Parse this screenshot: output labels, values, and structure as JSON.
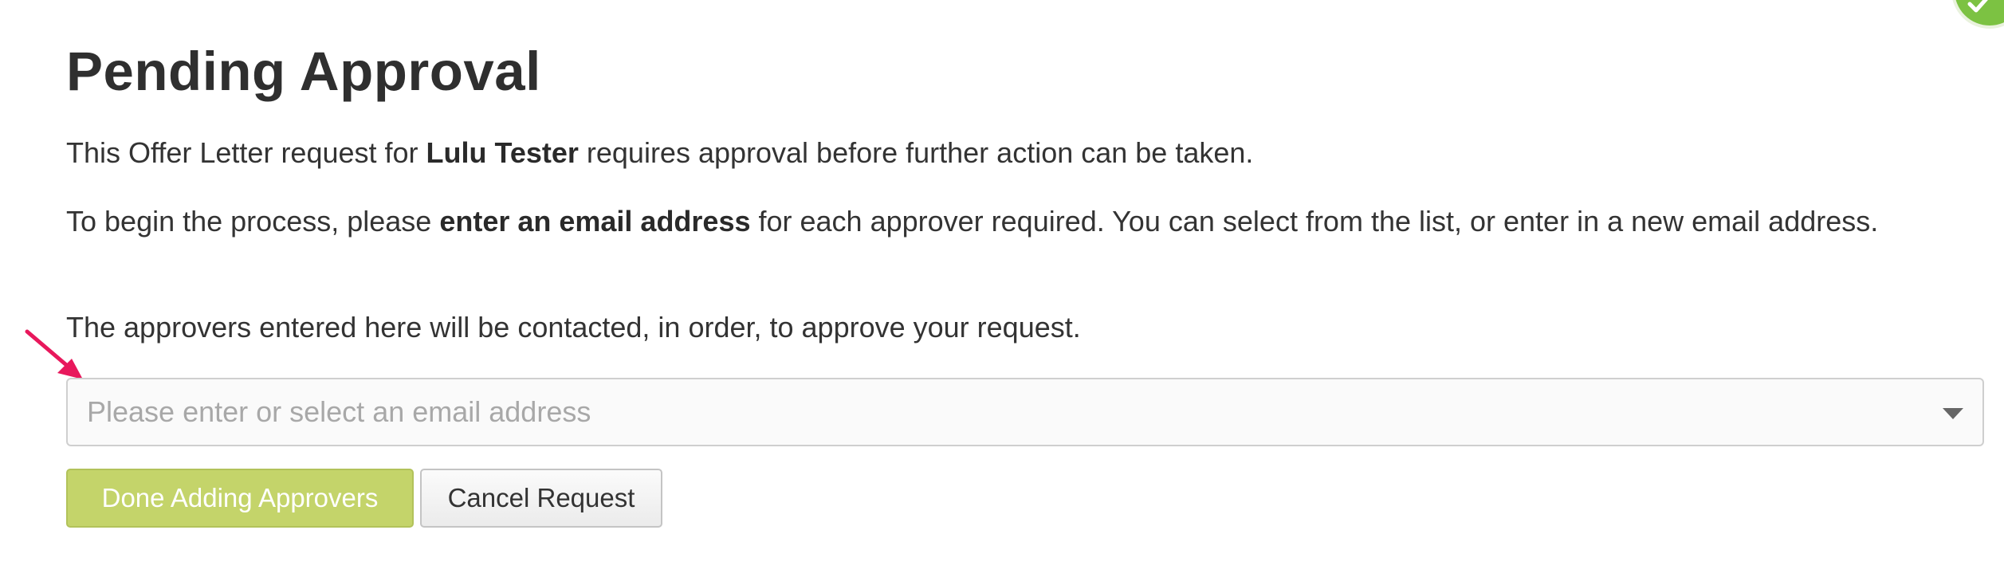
{
  "page": {
    "title": "Pending Approval"
  },
  "intro": {
    "pre": "This Offer Letter request for ",
    "name": "Lulu Tester",
    "post": " requires approval before further action can be taken."
  },
  "instructions": {
    "pre": "To begin the process, please ",
    "emphasis": "enter an email address",
    "post": " for each approver required. You can select from the list, or enter in a new email address."
  },
  "order_note": "The approvers entered here will be contacted, in order, to approve your request.",
  "approver_select": {
    "value": "",
    "placeholder": "Please enter or select an email address"
  },
  "actions": {
    "done_label": "Done Adding Approvers",
    "cancel_label": "Cancel Request"
  },
  "icons": {
    "dropdown": "chevron-down-icon",
    "annotation": "arrow-annotation-icon",
    "badge": "checkmark-icon"
  },
  "colors": {
    "primary_button": "#c4d46a",
    "annotation_arrow": "#e8185c",
    "badge": "#7cc242"
  }
}
